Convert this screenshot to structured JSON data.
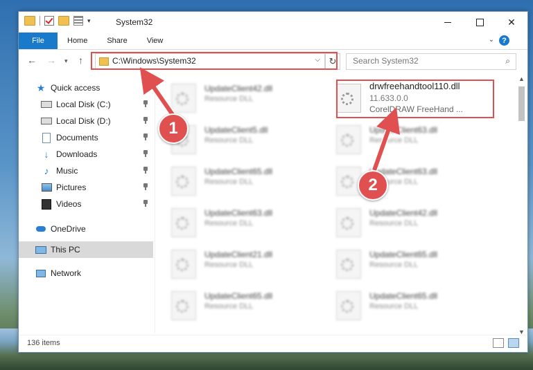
{
  "window": {
    "title": "System32",
    "file_tab": "File",
    "tabs": [
      "Home",
      "Share",
      "View"
    ],
    "help": "?"
  },
  "address": {
    "path": "C:\\Windows\\System32",
    "search_placeholder": "Search System32"
  },
  "sidebar": {
    "items": [
      {
        "label": "Quick access",
        "icon": "star-icon",
        "pinned": false
      },
      {
        "label": "Local Disk (C:)",
        "icon": "drive-icon",
        "pinned": true
      },
      {
        "label": "Local Disk (D:)",
        "icon": "drive-icon",
        "pinned": true
      },
      {
        "label": "Documents",
        "icon": "documents-icon",
        "pinned": true
      },
      {
        "label": "Downloads",
        "icon": "download-icon",
        "pinned": true
      },
      {
        "label": "Music",
        "icon": "music-icon",
        "pinned": true
      },
      {
        "label": "Pictures",
        "icon": "pictures-icon",
        "pinned": true
      },
      {
        "label": "Videos",
        "icon": "videos-icon",
        "pinned": true
      },
      {
        "label": "OneDrive",
        "icon": "cloud-icon",
        "pinned": false
      },
      {
        "label": "This PC",
        "icon": "computer-icon",
        "pinned": false,
        "selected": true
      },
      {
        "label": "Network",
        "icon": "network-icon",
        "pinned": false
      }
    ]
  },
  "files": {
    "highlighted": {
      "name": "drwfreehandtool110.dll",
      "version": "11.633.0.0",
      "desc": "CorelDRAW FreeHand ..."
    },
    "blurred": [
      {
        "name": "UpdateClient42.dll",
        "desc": "Resource DLL"
      },
      {
        "name": "UpdateClient5.dll",
        "desc": "Resource DLL"
      },
      {
        "name": "UpdateClient63.dll",
        "desc": "Resource DLL"
      },
      {
        "name": "UpdateClient65.dll",
        "desc": "Resource DLL"
      },
      {
        "name": "UpdateClient63.dll",
        "desc": "Resource DLL"
      },
      {
        "name": "UpdateClient63.dll",
        "desc": "Resource DLL"
      },
      {
        "name": "UpdateClient42.dll",
        "desc": "Resource DLL"
      },
      {
        "name": "UpdateClient21.dll",
        "desc": "Resource DLL"
      },
      {
        "name": "UpdateClient65.dll",
        "desc": "Resource DLL"
      },
      {
        "name": "UpdateClient65.dll",
        "desc": "Resource DLL"
      },
      {
        "name": "UpdateClient65.dll",
        "desc": "Resource DLL"
      }
    ]
  },
  "status": {
    "count": "136 items"
  },
  "callouts": [
    "1",
    "2"
  ],
  "colors": {
    "accent": "#1979ca",
    "highlight": "#e05050"
  }
}
